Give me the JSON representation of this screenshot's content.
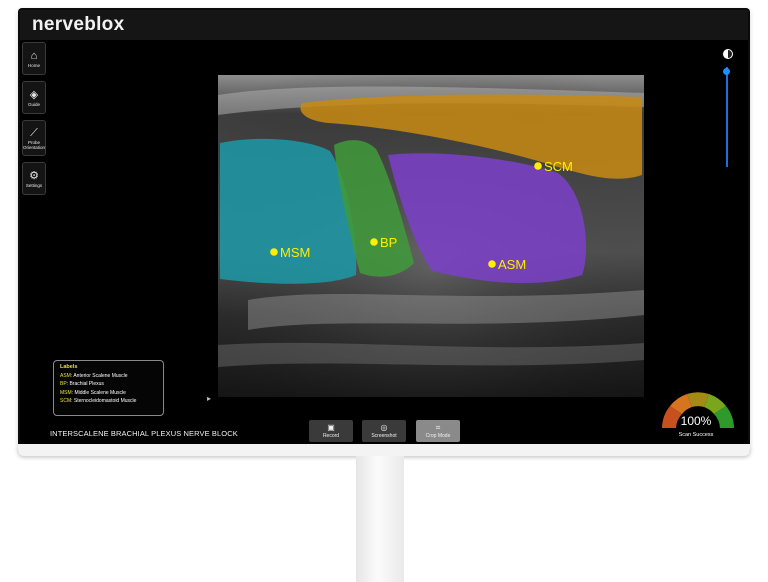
{
  "app": {
    "brand": "nerveblox"
  },
  "sidebar": {
    "items": [
      {
        "label": "Home",
        "icon": "home-icon"
      },
      {
        "label": "Guide",
        "icon": "graduation-cap-icon"
      },
      {
        "label": "Probe Orientation",
        "icon": "probe-icon"
      },
      {
        "label": "Settings",
        "icon": "gear-icon"
      }
    ]
  },
  "ultrasound": {
    "overlays": [
      {
        "label": "SCM",
        "color": "#c98a12"
      },
      {
        "label": "MSM",
        "color": "#1c9aa8"
      },
      {
        "label": "BP",
        "color": "#3f9a3a"
      },
      {
        "label": "ASM",
        "color": "#7b3fc9"
      }
    ],
    "dot_color": "#ffee00"
  },
  "labels_panel": {
    "title": "Labels",
    "entries": [
      {
        "abbr": "ASM",
        "full": ": Anterior Scalene Muscle"
      },
      {
        "abbr": "BP",
        "full": ": Brachial Plexus"
      },
      {
        "abbr": "MSM",
        "full": ": Middle Scalene Muscle"
      },
      {
        "abbr": "SCM",
        "full": ": Sternocleidomastoid Muscle"
      }
    ]
  },
  "footer": {
    "block_name": "INTERSCALENE BRACHIAL PLEXUS NERVE BLOCK",
    "buttons": [
      {
        "label": "Record",
        "icon": "record-icon"
      },
      {
        "label": "Screenshot",
        "icon": "camera-icon"
      },
      {
        "label": "Crop Mode",
        "icon": "crop-icon"
      }
    ]
  },
  "scan": {
    "percent": "100%",
    "label": "Scan Success",
    "value": 1.0
  },
  "controls": {
    "contrast_icon": "contrast-icon",
    "slider_level": 0.98,
    "accent": "#1f8fff"
  }
}
